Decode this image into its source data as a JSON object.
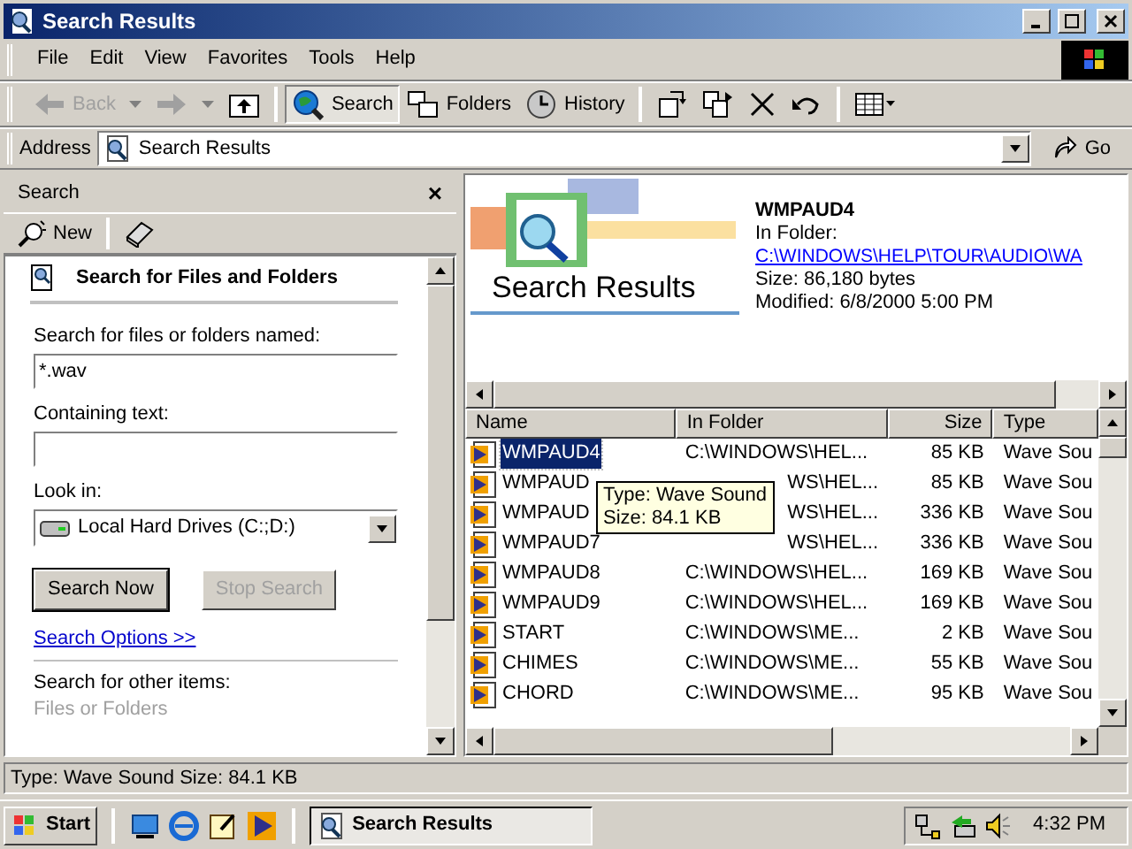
{
  "window": {
    "title": "Search Results"
  },
  "menu": [
    "File",
    "Edit",
    "View",
    "Favorites",
    "Tools",
    "Help"
  ],
  "toolbar": [
    {
      "kind": "back",
      "label": "Back",
      "disabled": true,
      "selected": false
    },
    {
      "kind": "forward",
      "disabled": true,
      "selected": false
    },
    {
      "kind": "up",
      "selected": false
    },
    {
      "kind": "search",
      "label": "Search",
      "selected": true
    },
    {
      "kind": "folders",
      "label": "Folders",
      "selected": false
    },
    {
      "kind": "history",
      "label": "History",
      "selected": false
    },
    {
      "kind": "move",
      "selected": false
    },
    {
      "kind": "copy",
      "selected": false
    },
    {
      "kind": "delete",
      "selected": false
    },
    {
      "kind": "undo",
      "selected": false
    },
    {
      "kind": "views",
      "selected": false
    }
  ],
  "address": {
    "label": "Address",
    "value": "Search Results",
    "go": "Go"
  },
  "search_pane": {
    "title": "Search",
    "close": "×",
    "new_label": "New",
    "heading": "Search for Files and Folders",
    "named_label": "Search for files or folders named:",
    "named_value": "*.wav",
    "containing_label": "Containing text:",
    "look_in_label": "Look in:",
    "look_in_value": "Local Hard Drives (C:;D:)",
    "search_now": "Search Now",
    "stop_search": {
      "label": "Stop Search",
      "disabled": true
    },
    "options_link": "Search Options >>",
    "other_label": "Search for other items:",
    "other_item": "Files or Folders"
  },
  "preview": {
    "banner_title": "Search Results",
    "name": "WMPAUD4",
    "in_folder_label": "In Folder:",
    "folder_link": "C:\\WINDOWS\\HELP\\TOUR\\AUDIO\\WA",
    "size": "Size: 86,180 bytes",
    "modified": "Modified: 6/8/2000 5:00 PM"
  },
  "table": {
    "columns": [
      "Name",
      "In Folder",
      "Size",
      "Type"
    ],
    "rows": [
      {
        "name": "WMPAUD4",
        "folder": "C:\\WINDOWS\\HEL...",
        "size": "85 KB",
        "type": "Wave Sou",
        "selected": true,
        "kind": "full"
      },
      {
        "name": "WMPAUD",
        "folder": "WS\\HEL...",
        "size": "85 KB",
        "type": "Wave Sou",
        "selected": false,
        "kind": "partly_hidden"
      },
      {
        "name": "WMPAUD",
        "folder": "WS\\HEL...",
        "size": "336 KB",
        "type": "Wave Sou",
        "selected": false,
        "kind": "partly_hidden"
      },
      {
        "name": "WMPAUD7",
        "folder": "WS\\HEL...",
        "size": "336 KB",
        "type": "Wave Sou",
        "selected": false,
        "kind": "partly_hidden"
      },
      {
        "name": "WMPAUD8",
        "folder": "C:\\WINDOWS\\HEL...",
        "size": "169 KB",
        "type": "Wave Sou",
        "selected": false,
        "kind": "full"
      },
      {
        "name": "WMPAUD9",
        "folder": "C:\\WINDOWS\\HEL...",
        "size": "169 KB",
        "type": "Wave Sou",
        "selected": false,
        "kind": "full"
      },
      {
        "name": "START",
        "folder": "C:\\WINDOWS\\ME...",
        "size": "2 KB",
        "type": "Wave Sou",
        "selected": false,
        "kind": "full"
      },
      {
        "name": "CHIMES",
        "folder": "C:\\WINDOWS\\ME...",
        "size": "55 KB",
        "type": "Wave Sou",
        "selected": false,
        "kind": "full"
      },
      {
        "name": "CHORD",
        "folder": "C:\\WINDOWS\\ME...",
        "size": "95 KB",
        "type": "Wave Sou",
        "selected": false,
        "kind": "full"
      }
    ]
  },
  "tooltip": [
    "Type: Wave Sound",
    "Size: 84.1 KB"
  ],
  "status_bar": "Type: Wave Sound Size: 84.1 KB",
  "taskbar": {
    "start": "Start",
    "task": "Search Results",
    "clock": "4:32 PM"
  }
}
